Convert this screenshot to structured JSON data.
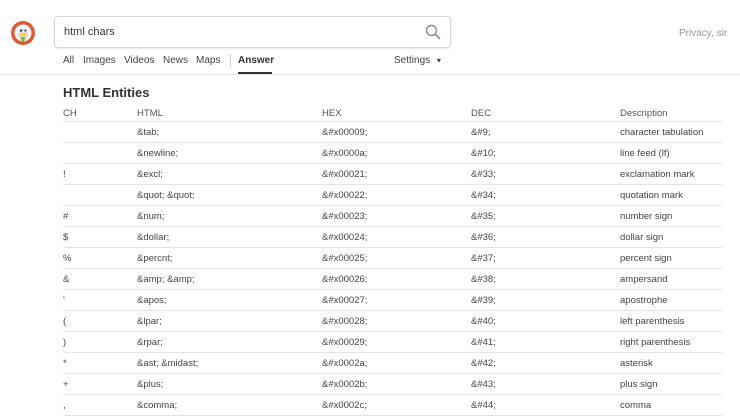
{
  "search": {
    "query": "html chars"
  },
  "header": {
    "privacy": "Privacy, sir"
  },
  "tabs": [
    {
      "label": "All"
    },
    {
      "label": "Images"
    },
    {
      "label": "Videos"
    },
    {
      "label": "News"
    },
    {
      "label": "Maps"
    },
    {
      "label": "Answer"
    }
  ],
  "settings": {
    "label": "Settings",
    "caret": "▾"
  },
  "answer": {
    "title": "HTML Entities",
    "columns": [
      "CH",
      "HTML",
      "HEX",
      "DEC",
      "Description"
    ],
    "rows": [
      {
        "ch": "",
        "html": "&tab;",
        "hex": "&#x00009;",
        "dec": "&#9;",
        "desc": "character tabulation"
      },
      {
        "ch": "",
        "html": "&newline;",
        "hex": "&#x0000a;",
        "dec": "&#10;",
        "desc": "line feed (lf)"
      },
      {
        "ch": "!",
        "html": "&excl;",
        "hex": "&#x00021;",
        "dec": "&#33;",
        "desc": "exclamation mark"
      },
      {
        "ch": "",
        "html": "&quot; &quot;",
        "hex": "&#x00022;",
        "dec": "&#34;",
        "desc": "quotation mark"
      },
      {
        "ch": "#",
        "html": "&num;",
        "hex": "&#x00023;",
        "dec": "&#35;",
        "desc": "number sign"
      },
      {
        "ch": "$",
        "html": "&dollar;",
        "hex": "&#x00024;",
        "dec": "&#36;",
        "desc": "dollar sign"
      },
      {
        "ch": "%",
        "html": "&percnt;",
        "hex": "&#x00025;",
        "dec": "&#37;",
        "desc": "percent sign"
      },
      {
        "ch": "&",
        "html": "&amp; &amp;",
        "hex": "&#x00026;",
        "dec": "&#38;",
        "desc": "ampersand"
      },
      {
        "ch": "'",
        "html": "&apos;",
        "hex": "&#x00027;",
        "dec": "&#39;",
        "desc": "apostrophe"
      },
      {
        "ch": "(",
        "html": "&lpar;",
        "hex": "&#x00028;",
        "dec": "&#40;",
        "desc": "left parenthesis"
      },
      {
        "ch": ")",
        "html": "&rpar;",
        "hex": "&#x00029;",
        "dec": "&#41;",
        "desc": "right parenthesis"
      },
      {
        "ch": "*",
        "html": "&ast; &midast;",
        "hex": "&#x0002a;",
        "dec": "&#42;",
        "desc": "asterisk"
      },
      {
        "ch": "+",
        "html": "&plus;",
        "hex": "&#x0002b;",
        "dec": "&#43;",
        "desc": "plus sign"
      },
      {
        "ch": ",",
        "html": "&comma;",
        "hex": "&#x0002c;",
        "dec": "&#44;",
        "desc": "comma"
      }
    ]
  }
}
